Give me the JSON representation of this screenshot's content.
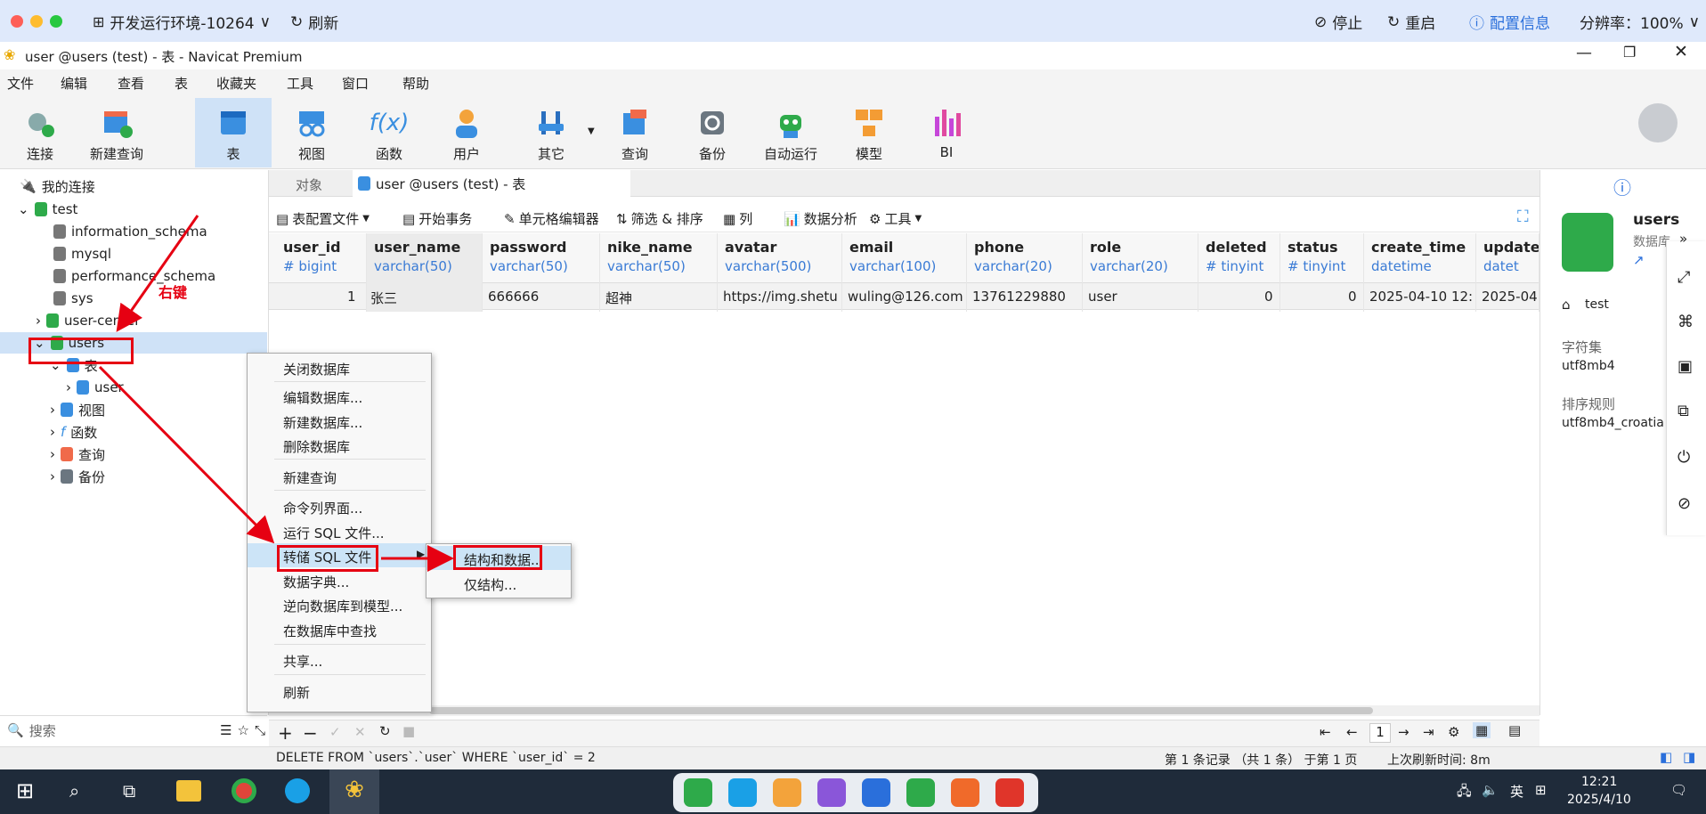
{
  "remote": {
    "title": "开发运行环境-10264",
    "refresh": "刷新",
    "stop": "停止",
    "restart": "重启",
    "config": "配置信息",
    "resolution": "分辨率：100%"
  },
  "window": {
    "title": "user @users (test) - 表 - Navicat Premium"
  },
  "menu": [
    "文件",
    "编辑",
    "查看",
    "表",
    "收藏夹",
    "工具",
    "窗口",
    "帮助"
  ],
  "toolbar": [
    "连接",
    "新建查询",
    "表",
    "视图",
    "函数",
    "用户",
    "其它",
    "查询",
    "备份",
    "自动运行",
    "模型",
    "BI"
  ],
  "sidebar": {
    "header": "我的连接",
    "connection": "test",
    "dbs": [
      "information_schema",
      "mysql",
      "performance_schema",
      "sys",
      "user-center",
      "users"
    ],
    "tables_node": "表",
    "table": "user",
    "nodes": [
      "视图",
      "函数",
      "查询",
      "备份"
    ],
    "search_placeholder": "搜索"
  },
  "annotation": {
    "right_click": "右键"
  },
  "tabs": {
    "objects": "对象",
    "active": "user @users (test) - 表"
  },
  "gridtool": {
    "config": "表配置文件",
    "begin": "开始事务",
    "cell_editor": "单元格编辑器",
    "filter": "筛选 & 排序",
    "columns": "列",
    "analysis": "数据分析",
    "tools": "工具"
  },
  "columns": [
    {
      "name": "user_id",
      "type": "# bigint"
    },
    {
      "name": "user_name",
      "type": "varchar(50)"
    },
    {
      "name": "password",
      "type": "varchar(50)"
    },
    {
      "name": "nike_name",
      "type": "varchar(50)"
    },
    {
      "name": "avatar",
      "type": "varchar(500)"
    },
    {
      "name": "email",
      "type": "varchar(100)"
    },
    {
      "name": "phone",
      "type": "varchar(20)"
    },
    {
      "name": "role",
      "type": "varchar(20)"
    },
    {
      "name": "deleted",
      "type": "# tinyint"
    },
    {
      "name": "status",
      "type": "# tinyint"
    },
    {
      "name": "create_time",
      "type": "datetime"
    },
    {
      "name": "update",
      "type": "datet"
    }
  ],
  "row": [
    "1",
    "张三",
    "666666",
    "超神",
    "https://img.shetu(",
    "wuling@126.com",
    "13761229880",
    "user",
    "0",
    "0",
    "2025-04-10 12:1",
    "2025-04-"
  ],
  "context_menu": [
    "关闭数据库",
    "编辑数据库...",
    "新建数据库...",
    "删除数据库",
    "新建查询",
    "命令列界面...",
    "运行 SQL 文件...",
    "转储 SQL 文件",
    "数据字典...",
    "逆向数据库到模型...",
    "在数据库中查找",
    "共享...",
    "刷新"
  ],
  "submenu": [
    "结构和数据...",
    "仅结构..."
  ],
  "rightpanel": {
    "name": "users",
    "kind": "数据库",
    "conn": "test",
    "charset_label": "字符集",
    "charset": "utf8mb4",
    "collation_label": "排序规则",
    "collation": "utf8mb4_croatia"
  },
  "pager": {
    "page": "1"
  },
  "status": {
    "sql": "DELETE FROM `users`.`user` WHERE `user_id` = 2",
    "records": "第 1 条记录 （共 1 条） 于第 1 页",
    "refresh": "上次刷新时间: 8m"
  },
  "taskbar": {
    "time": "12:21",
    "date": "2025/4/10",
    "lang": "英"
  }
}
